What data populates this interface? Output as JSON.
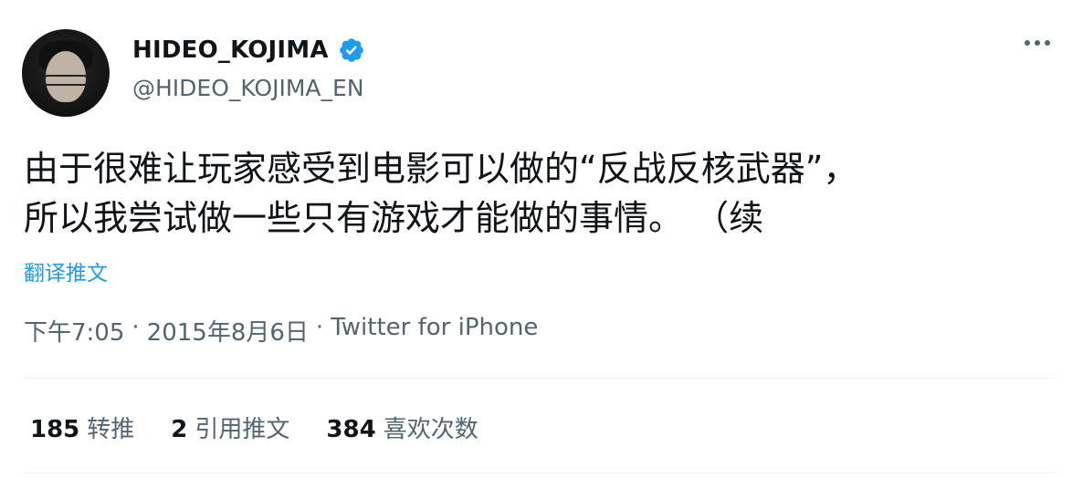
{
  "author": {
    "display_name": "HIDEO_KOJIMA",
    "handle": "@HIDEO_KOJIMA_EN",
    "verified": true
  },
  "tweet": {
    "line1": "由于很难让玩家感受到电影可以做的“反战反核武器”，",
    "line2": "所以我尝试做一些只有游戏才能做的事情。 （续",
    "translate_label": "翻译推文"
  },
  "meta": {
    "time": "下午7:05",
    "sep1": "·",
    "date": "2015年8月6日",
    "sep2": "·",
    "source": "Twitter for iPhone"
  },
  "stats": [
    {
      "count": "185",
      "label": "转推"
    },
    {
      "count": "2",
      "label": "引用推文"
    },
    {
      "count": "384",
      "label": "喜欢次数"
    }
  ],
  "colors": {
    "accent": "#1d9bf0",
    "secondary_text": "#536471",
    "primary_text": "#0f1419"
  }
}
